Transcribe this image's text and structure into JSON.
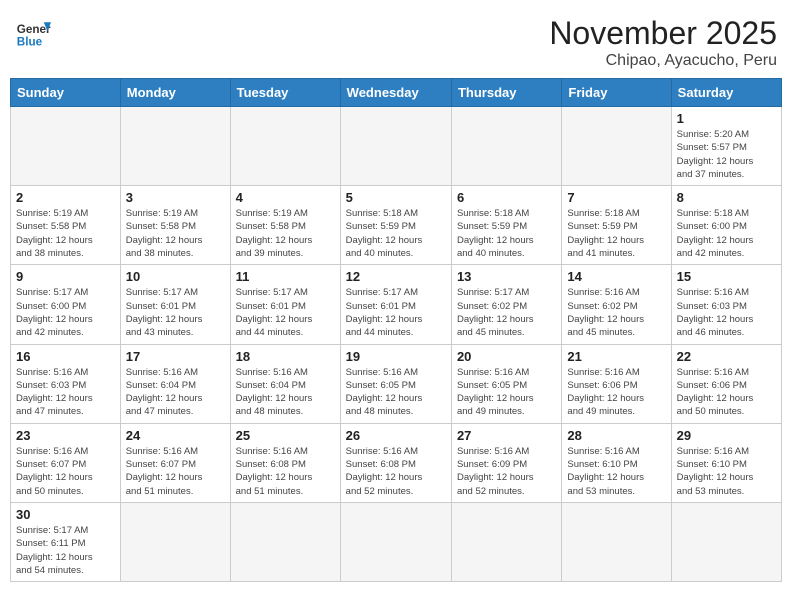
{
  "header": {
    "logo_general": "General",
    "logo_blue": "Blue",
    "title": "November 2025",
    "subtitle": "Chipao, Ayacucho, Peru"
  },
  "days_of_week": [
    "Sunday",
    "Monday",
    "Tuesday",
    "Wednesday",
    "Thursday",
    "Friday",
    "Saturday"
  ],
  "weeks": [
    [
      {
        "day": "",
        "info": ""
      },
      {
        "day": "",
        "info": ""
      },
      {
        "day": "",
        "info": ""
      },
      {
        "day": "",
        "info": ""
      },
      {
        "day": "",
        "info": ""
      },
      {
        "day": "",
        "info": ""
      },
      {
        "day": "1",
        "info": "Sunrise: 5:20 AM\nSunset: 5:57 PM\nDaylight: 12 hours\nand 37 minutes."
      }
    ],
    [
      {
        "day": "2",
        "info": "Sunrise: 5:19 AM\nSunset: 5:58 PM\nDaylight: 12 hours\nand 38 minutes."
      },
      {
        "day": "3",
        "info": "Sunrise: 5:19 AM\nSunset: 5:58 PM\nDaylight: 12 hours\nand 38 minutes."
      },
      {
        "day": "4",
        "info": "Sunrise: 5:19 AM\nSunset: 5:58 PM\nDaylight: 12 hours\nand 39 minutes."
      },
      {
        "day": "5",
        "info": "Sunrise: 5:18 AM\nSunset: 5:59 PM\nDaylight: 12 hours\nand 40 minutes."
      },
      {
        "day": "6",
        "info": "Sunrise: 5:18 AM\nSunset: 5:59 PM\nDaylight: 12 hours\nand 40 minutes."
      },
      {
        "day": "7",
        "info": "Sunrise: 5:18 AM\nSunset: 5:59 PM\nDaylight: 12 hours\nand 41 minutes."
      },
      {
        "day": "8",
        "info": "Sunrise: 5:18 AM\nSunset: 6:00 PM\nDaylight: 12 hours\nand 42 minutes."
      }
    ],
    [
      {
        "day": "9",
        "info": "Sunrise: 5:17 AM\nSunset: 6:00 PM\nDaylight: 12 hours\nand 42 minutes."
      },
      {
        "day": "10",
        "info": "Sunrise: 5:17 AM\nSunset: 6:01 PM\nDaylight: 12 hours\nand 43 minutes."
      },
      {
        "day": "11",
        "info": "Sunrise: 5:17 AM\nSunset: 6:01 PM\nDaylight: 12 hours\nand 44 minutes."
      },
      {
        "day": "12",
        "info": "Sunrise: 5:17 AM\nSunset: 6:01 PM\nDaylight: 12 hours\nand 44 minutes."
      },
      {
        "day": "13",
        "info": "Sunrise: 5:17 AM\nSunset: 6:02 PM\nDaylight: 12 hours\nand 45 minutes."
      },
      {
        "day": "14",
        "info": "Sunrise: 5:16 AM\nSunset: 6:02 PM\nDaylight: 12 hours\nand 45 minutes."
      },
      {
        "day": "15",
        "info": "Sunrise: 5:16 AM\nSunset: 6:03 PM\nDaylight: 12 hours\nand 46 minutes."
      }
    ],
    [
      {
        "day": "16",
        "info": "Sunrise: 5:16 AM\nSunset: 6:03 PM\nDaylight: 12 hours\nand 47 minutes."
      },
      {
        "day": "17",
        "info": "Sunrise: 5:16 AM\nSunset: 6:04 PM\nDaylight: 12 hours\nand 47 minutes."
      },
      {
        "day": "18",
        "info": "Sunrise: 5:16 AM\nSunset: 6:04 PM\nDaylight: 12 hours\nand 48 minutes."
      },
      {
        "day": "19",
        "info": "Sunrise: 5:16 AM\nSunset: 6:05 PM\nDaylight: 12 hours\nand 48 minutes."
      },
      {
        "day": "20",
        "info": "Sunrise: 5:16 AM\nSunset: 6:05 PM\nDaylight: 12 hours\nand 49 minutes."
      },
      {
        "day": "21",
        "info": "Sunrise: 5:16 AM\nSunset: 6:06 PM\nDaylight: 12 hours\nand 49 minutes."
      },
      {
        "day": "22",
        "info": "Sunrise: 5:16 AM\nSunset: 6:06 PM\nDaylight: 12 hours\nand 50 minutes."
      }
    ],
    [
      {
        "day": "23",
        "info": "Sunrise: 5:16 AM\nSunset: 6:07 PM\nDaylight: 12 hours\nand 50 minutes."
      },
      {
        "day": "24",
        "info": "Sunrise: 5:16 AM\nSunset: 6:07 PM\nDaylight: 12 hours\nand 51 minutes."
      },
      {
        "day": "25",
        "info": "Sunrise: 5:16 AM\nSunset: 6:08 PM\nDaylight: 12 hours\nand 51 minutes."
      },
      {
        "day": "26",
        "info": "Sunrise: 5:16 AM\nSunset: 6:08 PM\nDaylight: 12 hours\nand 52 minutes."
      },
      {
        "day": "27",
        "info": "Sunrise: 5:16 AM\nSunset: 6:09 PM\nDaylight: 12 hours\nand 52 minutes."
      },
      {
        "day": "28",
        "info": "Sunrise: 5:16 AM\nSunset: 6:10 PM\nDaylight: 12 hours\nand 53 minutes."
      },
      {
        "day": "29",
        "info": "Sunrise: 5:16 AM\nSunset: 6:10 PM\nDaylight: 12 hours\nand 53 minutes."
      }
    ],
    [
      {
        "day": "30",
        "info": "Sunrise: 5:17 AM\nSunset: 6:11 PM\nDaylight: 12 hours\nand 54 minutes."
      },
      {
        "day": "",
        "info": ""
      },
      {
        "day": "",
        "info": ""
      },
      {
        "day": "",
        "info": ""
      },
      {
        "day": "",
        "info": ""
      },
      {
        "day": "",
        "info": ""
      },
      {
        "day": "",
        "info": ""
      }
    ]
  ]
}
